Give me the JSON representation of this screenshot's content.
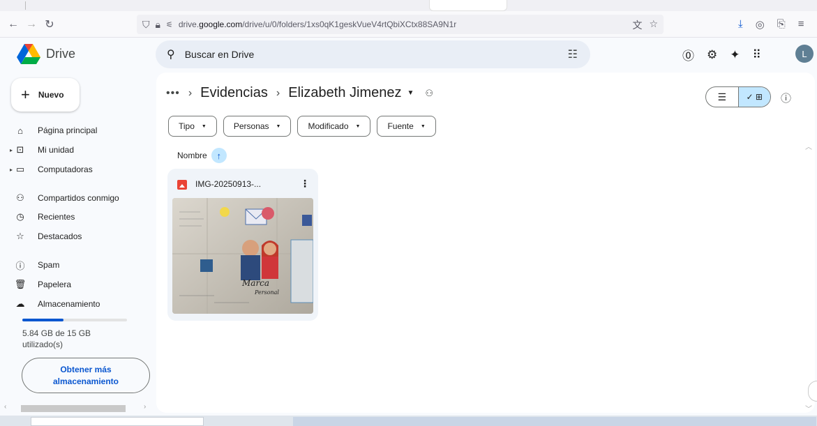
{
  "browser": {
    "url_prefix": "drive.",
    "url_domain": "google.com",
    "url_path": "/drive/u/0/folders/1xs0qK1geskVueV4rtQbiXCtx88SA9N1r"
  },
  "header": {
    "brand": "Drive",
    "search_placeholder": "Buscar en Drive",
    "avatar_letter": "L"
  },
  "sidebar": {
    "new_label": "Nuevo",
    "items": [
      {
        "label": "Página principal",
        "icon": "home-icon"
      },
      {
        "label": "Mi unidad",
        "icon": "my-drive-icon"
      },
      {
        "label": "Computadoras",
        "icon": "computers-icon"
      },
      {
        "label": "Compartidos conmigo",
        "icon": "shared-icon"
      },
      {
        "label": "Recientes",
        "icon": "clock-icon"
      },
      {
        "label": "Destacados",
        "icon": "star-icon"
      },
      {
        "label": "Spam",
        "icon": "spam-icon"
      },
      {
        "label": "Papelera",
        "icon": "trash-icon"
      },
      {
        "label": "Almacenamiento",
        "icon": "cloud-icon"
      }
    ],
    "storage_used_fraction": 0.39,
    "storage_text_line1": "5.84 GB de 15 GB",
    "storage_text_line2": "utilizado(s)",
    "more_storage_label": "Obtener más almacenamiento"
  },
  "main": {
    "breadcrumb": {
      "dots": "•••",
      "parent": "Evidencias",
      "current": "Elizabeth Jimenez"
    },
    "filters": [
      "Tipo",
      "Personas",
      "Modificado",
      "Fuente"
    ],
    "sort_label": "Nombre",
    "files": [
      {
        "name": "IMG-20250913-...",
        "type": "image"
      }
    ]
  },
  "colors": {
    "accent": "#0b57d0",
    "selected": "#c2e7ff",
    "image_icon": "#ea4335"
  }
}
